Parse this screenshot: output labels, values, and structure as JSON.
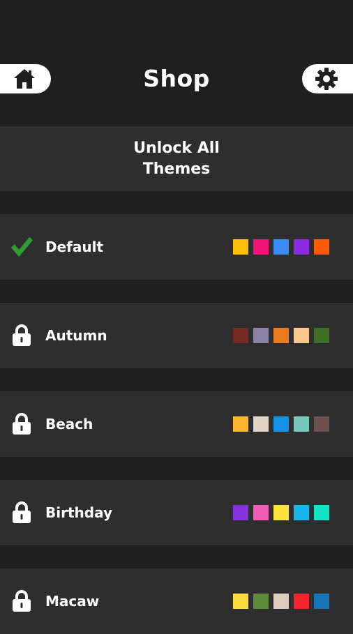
{
  "header": {
    "title": "Shop",
    "home_icon": "home-icon",
    "settings_icon": "gear-icon"
  },
  "unlock_all": {
    "line1": "Unlock All",
    "line2": "Themes"
  },
  "themes": [
    {
      "name": "Default",
      "status": "selected",
      "icon": "check-icon",
      "colors": [
        "#FFBE0B",
        "#F01479",
        "#3C8CF5",
        "#8A2BE2",
        "#FF5A0A"
      ]
    },
    {
      "name": "Autumn",
      "status": "locked",
      "icon": "lock-icon",
      "colors": [
        "#7A2A24",
        "#8C82A6",
        "#EC7A1E",
        "#FBC98E",
        "#3C6E26"
      ]
    },
    {
      "name": "Beach",
      "status": "locked",
      "icon": "lock-icon",
      "colors": [
        "#FBB52B",
        "#E2D4C4",
        "#1593E6",
        "#76C9BA",
        "#6B514E"
      ]
    },
    {
      "name": "Birthday",
      "status": "locked",
      "icon": "lock-icon",
      "colors": [
        "#8631DE",
        "#F45BB5",
        "#FCE23A",
        "#17B7EE",
        "#12E5C6"
      ]
    },
    {
      "name": "Macaw",
      "status": "locked",
      "icon": "lock-icon",
      "colors": [
        "#FDDA3E",
        "#5C8D3B",
        "#DCCBBE",
        "#F2232C",
        "#1676B8"
      ]
    }
  ],
  "colors": {
    "background": "#1f1f1f",
    "row": "#2e2e2e",
    "check": "#2e9e32",
    "text": "#ffffff"
  }
}
